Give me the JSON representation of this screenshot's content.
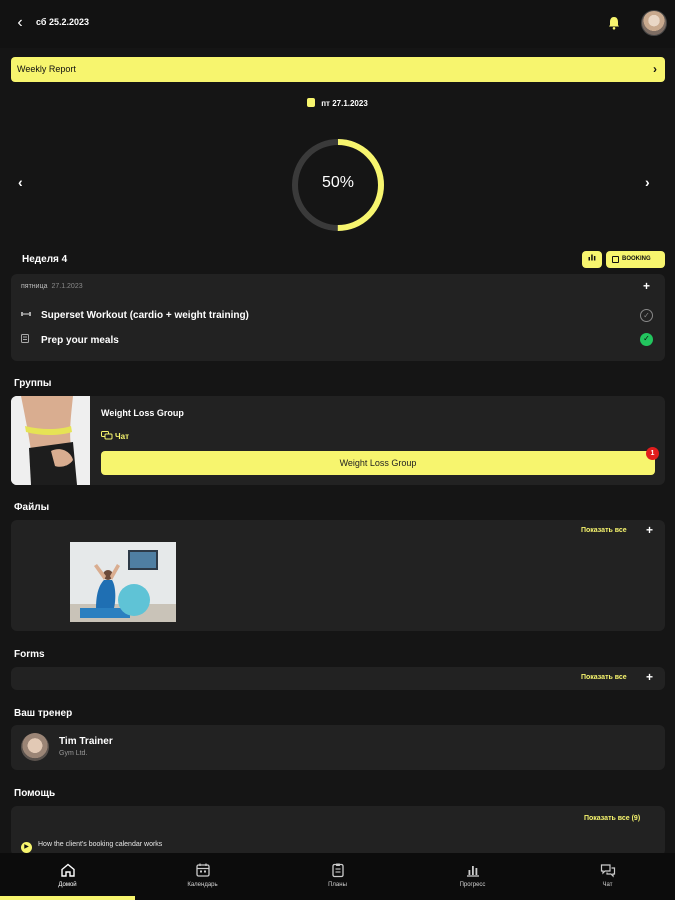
{
  "header": {
    "date": "сб 25.2.2023"
  },
  "weekly_report": {
    "label": "Weekly Report"
  },
  "current_day": {
    "date": "пт 27.1.2023",
    "progress_label": "50%",
    "progress": 0.5
  },
  "week": {
    "title": "Неделя 4",
    "booking_label": "BOOKING"
  },
  "day_card": {
    "weekday": "пятница",
    "date": "27.1.2023",
    "tasks": [
      {
        "label": "Superset Workout (cardio + weight training)",
        "status": "pending"
      },
      {
        "label": "Prep your meals",
        "status": "done"
      }
    ]
  },
  "groups": {
    "title": "Группы",
    "name": "Weight Loss Group",
    "chat_label": "Чат",
    "button_label": "Weight Loss Group",
    "badge": "1"
  },
  "files": {
    "title": "Файлы",
    "show_all": "Показать все"
  },
  "forms": {
    "title": "Forms",
    "show_all": "Показать все"
  },
  "trainer": {
    "title": "Ваш тренер",
    "name": "Tim Trainer",
    "company": "Gym Ltd."
  },
  "help": {
    "title": "Помощь",
    "show_all": "Показать все (9)",
    "items": [
      "How the client's booking calendar works"
    ]
  },
  "nav": [
    {
      "label": "Домой",
      "icon": "home-icon",
      "active": true
    },
    {
      "label": "Календарь",
      "icon": "calendar-icon"
    },
    {
      "label": "Планы",
      "icon": "clipboard-icon"
    },
    {
      "label": "Прогресс",
      "icon": "chart-icon"
    },
    {
      "label": "Чат",
      "icon": "chat-icon"
    }
  ],
  "colors": {
    "accent": "#f7f56e",
    "background": "#151515",
    "card": "#222222",
    "success": "#22c55e",
    "badge": "#e11d1d"
  }
}
